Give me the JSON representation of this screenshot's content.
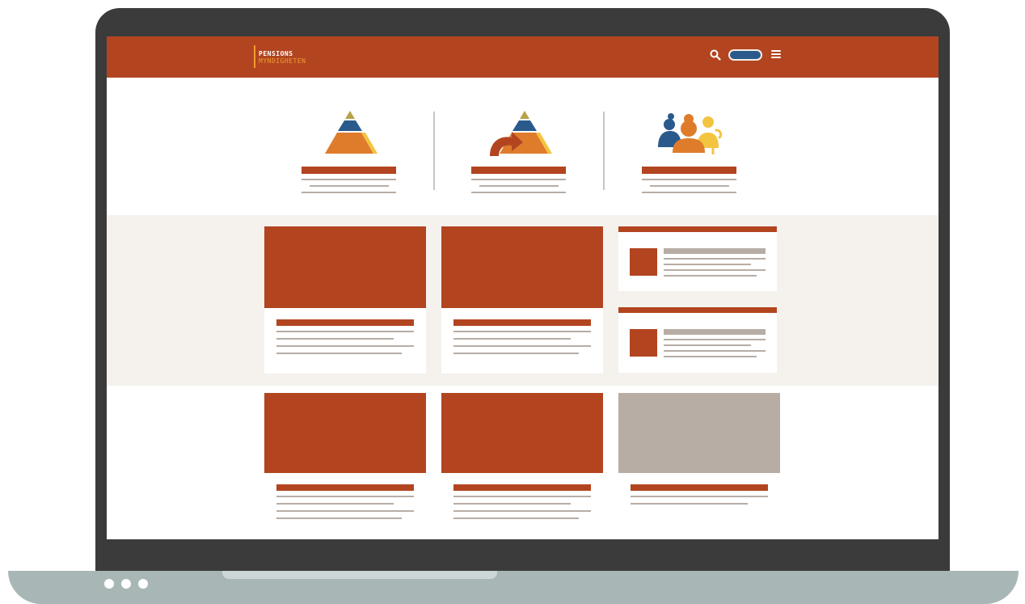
{
  "logo": {
    "line1": "PENSIONS",
    "line2": "MYNDIGHETEN"
  },
  "header": {
    "icons": [
      "search-icon",
      "login-toggle",
      "menu-icon"
    ]
  },
  "features": [
    {
      "icon": "pyramid-icon"
    },
    {
      "icon": "pyramid-arrow-icon"
    },
    {
      "icon": "people-icon"
    }
  ],
  "colors": {
    "brand": "#b24520",
    "accent_orange": "#f29c33",
    "accent_blue": "#2a5a8c",
    "placeholder_gray": "#b7ada5",
    "band_background": "#f5f2ee"
  }
}
